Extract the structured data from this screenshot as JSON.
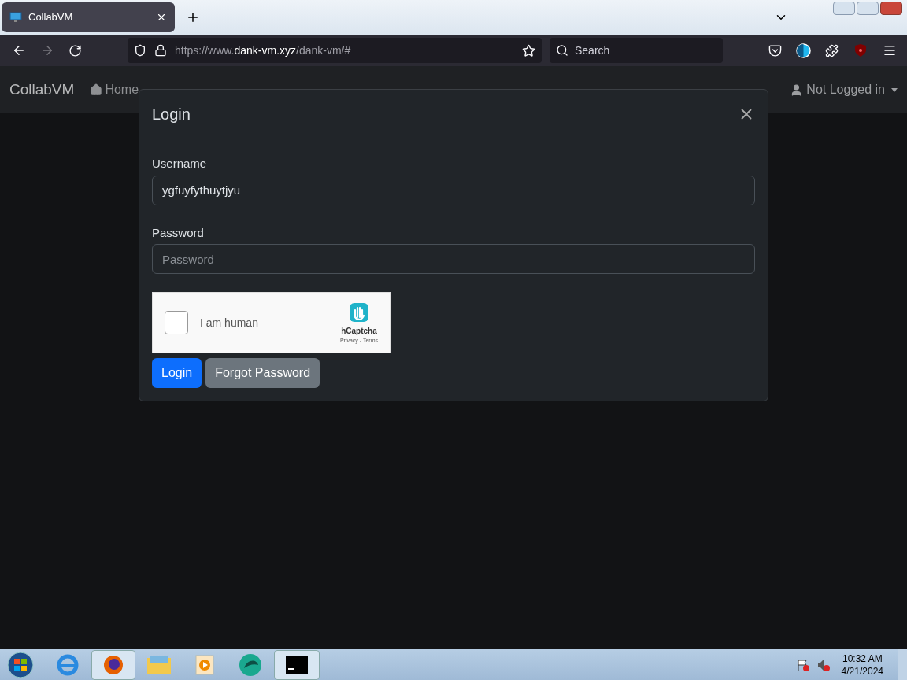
{
  "browser": {
    "tab": {
      "title": "CollabVM",
      "selected": true
    },
    "url": {
      "prefix": "https://www.",
      "domain": "dank-vm.xyz",
      "path": "/dank-vm/#"
    },
    "search": {
      "placeholder": "Search"
    }
  },
  "navbar": {
    "brand": "CollabVM",
    "items": [
      "Home"
    ],
    "user": "Not Logged in"
  },
  "modal": {
    "title": "Login",
    "fields": [
      {
        "label": "Username",
        "value": "ygfuyfythuytjyu"
      },
      {
        "label": "Password",
        "placeholder": "Password"
      }
    ],
    "captcha": {
      "label": "I am human",
      "checked": false,
      "brand": "hCaptcha",
      "links": "Privacy - Terms"
    },
    "buttons": [
      {
        "label": "Login",
        "kind": "primary"
      },
      {
        "label": "Forgot Password",
        "kind": "secondary"
      }
    ]
  },
  "taskbar": {
    "time": "10:32 AM",
    "date": "4/21/2024"
  }
}
